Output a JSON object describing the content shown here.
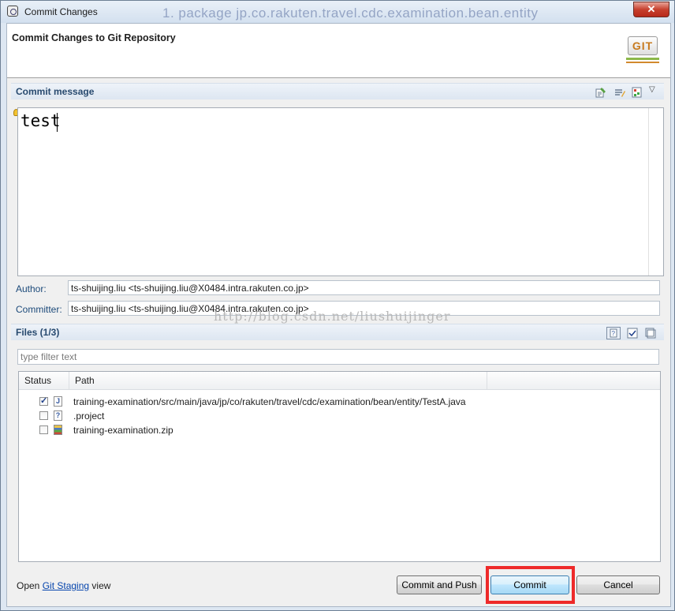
{
  "window": {
    "title": "Commit Changes",
    "close_label": "✕"
  },
  "background_text": "1. package jp.co.rakuten.travel.cdc.examination.bean.entity",
  "banner": {
    "heading": "Commit Changes to Git Repository",
    "logo_text": "GIT"
  },
  "commit_message": {
    "section_label": "Commit message",
    "text": "test"
  },
  "author": {
    "label": "Author:",
    "value": "ts-shuijing.liu <ts-shuijing.liu@X0484.intra.rakuten.co.jp>"
  },
  "committer": {
    "label": "Committer:",
    "value": "ts-shuijing.liu <ts-shuijing.liu@X0484.intra.rakuten.co.jp>"
  },
  "watermark": "http://blog.csdn.net/liushuijinger",
  "files": {
    "section_label": "Files (1/3)",
    "filter_placeholder": "type filter text",
    "columns": [
      "Status",
      "Path"
    ],
    "rows": [
      {
        "checked": true,
        "icon": "java-file-icon",
        "icon_glyph": "J",
        "path": "training-examination/src/main/java/jp/co/rakuten/travel/cdc/examination/bean/entity/TestA.java"
      },
      {
        "checked": false,
        "icon": "unknown-file-icon",
        "icon_glyph": "?",
        "path": ".project"
      },
      {
        "checked": false,
        "icon": "zip-file-icon",
        "icon_glyph": "",
        "path": "training-examination.zip"
      }
    ]
  },
  "footer": {
    "prefix": "Open ",
    "link": "Git Staging",
    "suffix": " view"
  },
  "buttons": {
    "commit_and_push": "Commit and Push",
    "commit": "Commit",
    "cancel": "Cancel"
  },
  "colors": {
    "highlight": "#ee2a2a",
    "section_label": "#284a6f",
    "link": "#0645ad"
  }
}
